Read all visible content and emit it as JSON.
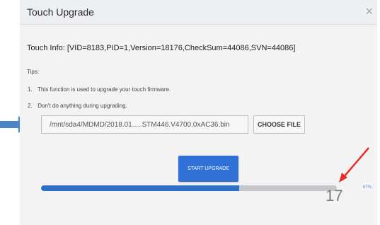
{
  "dialog": {
    "title": "Touch Upgrade",
    "close_label": "×"
  },
  "info": {
    "touch_info": "Touch Info: [VID=8183,PID=1,Version=18176,CheckSum=44086,SVN=44086]",
    "tips_label": "Tips:",
    "tips": [
      {
        "num": "1.",
        "text": "This function is used to upgrade your touch firmware."
      },
      {
        "num": "2.",
        "text": "Don't do anything during upgrading."
      }
    ]
  },
  "file": {
    "path": "/mnt/sda4/MDMD/2018.01.....STM446.V4700.0xAC36.bin",
    "choose_label": "CHOOSE FILE"
  },
  "upgrade": {
    "start_label": "START UPGRADE",
    "progress_fraction": 0.67,
    "progress_text": "67%"
  },
  "annotation": {
    "overlay_number": "17"
  },
  "colors": {
    "accent": "#2f71d6",
    "progress_fill": "#2f6ec9",
    "progress_track": "#c6c7ca",
    "annotation_arrow_blue": "#4a86c7",
    "annotation_arrow_red": "#e5302a"
  }
}
